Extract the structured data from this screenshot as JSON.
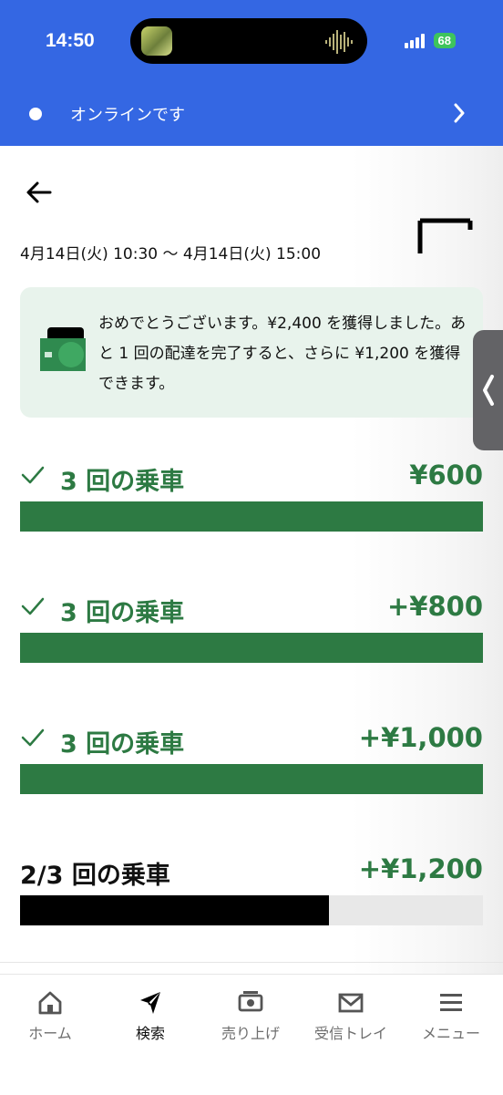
{
  "status_bar": {
    "time": "14:50",
    "battery": "68"
  },
  "online_banner": {
    "text": "オンラインです"
  },
  "period": {
    "range": "4月14日(火) 10:30 〜 4月14日(火) 15:00"
  },
  "message": {
    "text": "おめでとうございます。¥2,400 を獲得しました。あと 1 回の配達を完了すると、さらに ¥1,200 を獲得できます。"
  },
  "tiers": [
    {
      "label": "3 回の乗車",
      "amount": "¥600",
      "progress": 1.0,
      "completed": true
    },
    {
      "label": "3 回の乗車",
      "amount": "+¥800",
      "progress": 1.0,
      "completed": true
    },
    {
      "label": "3 回の乗車",
      "amount": "+¥1,000",
      "progress": 1.0,
      "completed": true
    },
    {
      "label": "2/3 回の乗車",
      "amount": "+¥1,200",
      "progress": 0.667,
      "completed": false
    }
  ],
  "tabs": [
    {
      "label": "ホーム",
      "icon": "home-icon"
    },
    {
      "label": "検索",
      "icon": "compass-icon"
    },
    {
      "label": "売り上げ",
      "icon": "money-icon"
    },
    {
      "label": "受信トレイ",
      "icon": "mail-icon"
    },
    {
      "label": "メニュー",
      "icon": "menu-icon"
    }
  ],
  "colors": {
    "header_blue": "#3467e3",
    "accent_green": "#2d7a43",
    "banner_bg": "#e8f3ec"
  }
}
